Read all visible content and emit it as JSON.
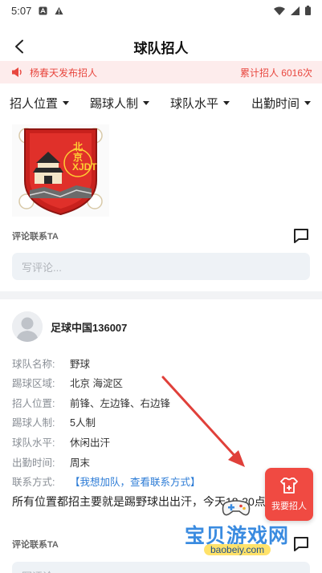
{
  "status_bar": {
    "time": "5:07"
  },
  "nav": {
    "title": "球队招人"
  },
  "notice": {
    "left": "杨春天发布招人",
    "right": "累计招人 6016次"
  },
  "filters": [
    {
      "label": "招人位置"
    },
    {
      "label": "踢球人制"
    },
    {
      "label": "球队水平"
    },
    {
      "label": "出勤时间"
    }
  ],
  "post1": {
    "badge": {
      "text": "北京XJDT"
    },
    "comment_label": "评论联系TA",
    "comment_placeholder": "写评论..."
  },
  "post2": {
    "username": "足球中国136007",
    "info": [
      {
        "label": "球队名称:",
        "value": "野球"
      },
      {
        "label": "踢球区域:",
        "value": "北京 海淀区"
      },
      {
        "label": "招人位置:",
        "value": "前锋、左边锋、右边锋"
      },
      {
        "label": "踢球人制:",
        "value": "5人制"
      },
      {
        "label": "球队水平:",
        "value": "休闲出汗"
      },
      {
        "label": "出勤时间:",
        "value": "周末"
      },
      {
        "label": "联系方式:",
        "value": "【我想加队，查看联系方式】"
      }
    ],
    "description": "所有位置都招主要就是踢野球出出汗，今天18-20点 公园aa",
    "comment_label": "评论联系TA",
    "comment_placeholder": "写评论..."
  },
  "fab": {
    "label": "我要招人"
  },
  "watermark": {
    "title": "宝贝游戏网",
    "url": "baobeiy.com"
  },
  "colors": {
    "accent": "#f04a42",
    "notice_bg": "#fdecec",
    "link": "#2b7bd6"
  }
}
